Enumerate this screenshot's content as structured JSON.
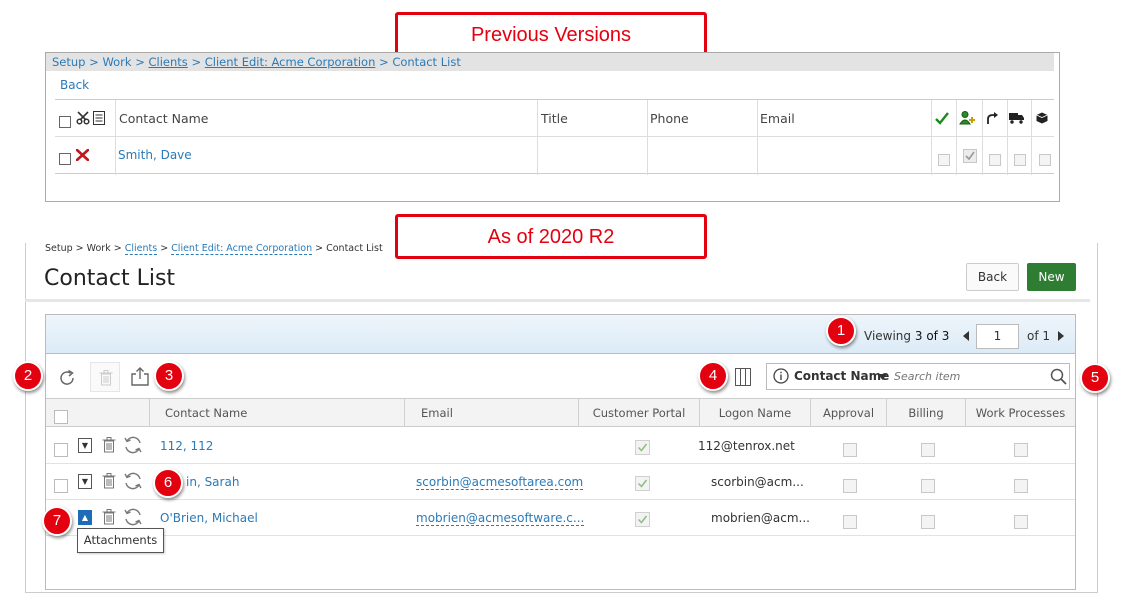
{
  "callouts": {
    "previous": "Previous Versions",
    "current": "As of 2020 R2",
    "badges": [
      "1",
      "2",
      "3",
      "4",
      "5",
      "6",
      "7"
    ]
  },
  "old": {
    "breadcrumb": {
      "setup": "Setup",
      "sep1": " > ",
      "work": "Work",
      "sep2": " > ",
      "clients": "Clients",
      "sep3": " > ",
      "client_edit": "Client Edit: Acme Corporation",
      "sep4": " > ",
      "current": "Contact List"
    },
    "back": "Back",
    "columns": {
      "contact_name": "Contact Name",
      "title": "Title",
      "phone": "Phone",
      "email": "Email"
    },
    "header_icons": [
      "check-icon",
      "add-user-icon",
      "redo-arrow-icon",
      "truck-icon",
      "box-icon"
    ],
    "rows": [
      {
        "name": "Smith, Dave",
        "checks": [
          false,
          true,
          false,
          false,
          false
        ]
      }
    ]
  },
  "new": {
    "breadcrumb": {
      "setup": "Setup",
      "work": "Work",
      "clients": "Clients",
      "client_edit": "Client Edit: Acme Corporation",
      "current": "Contact List",
      "sep": " > "
    },
    "title": "Contact List",
    "buttons": {
      "back": "Back",
      "new": "New"
    },
    "pager": {
      "viewing_label": "Viewing",
      "range": "3 of 3",
      "page": "1",
      "of_label": "of 1"
    },
    "search": {
      "field": "Contact Name",
      "placeholder": "Search item"
    },
    "columns": {
      "contact_name": "Contact Name",
      "email": "Email",
      "customer_portal": "Customer Portal",
      "logon_name": "Logon Name",
      "approval": "Approval",
      "billing": "Billing",
      "work_processes": "Work Processes"
    },
    "rows": [
      {
        "name": "112, 112",
        "email": "",
        "logon": "112@tenrox.net",
        "portal": true
      },
      {
        "name": "in, Sarah",
        "email": "scorbin@acmesoftarea.com",
        "logon": "scorbin@acm...",
        "portal": true
      },
      {
        "name": "O'Brien, Michael",
        "email": "mobrien@acmesoftware.c...",
        "logon": "mobrien@acm...",
        "portal": true
      }
    ],
    "tooltip": "Attachments"
  },
  "colors": {
    "callout_red": "#e3000f",
    "link_blue": "#2a7ab7",
    "new_button_green": "#2e7d32",
    "active_blue": "#1e6bb8"
  }
}
